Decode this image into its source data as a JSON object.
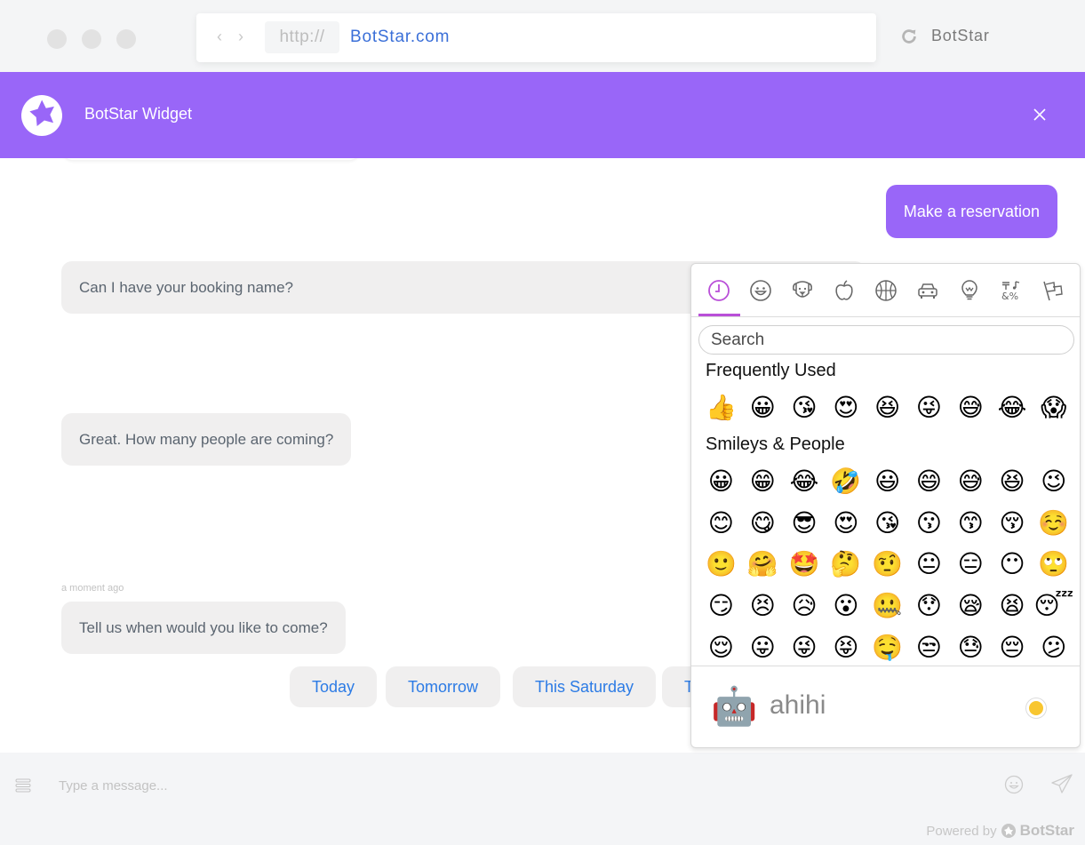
{
  "browser": {
    "protocol": "http://",
    "domain": "BotStar.com",
    "tab_title": "BotStar"
  },
  "widget": {
    "title": "BotStar Widget",
    "colors": {
      "brand": "#9966f8",
      "link": "#2c7be5",
      "bubble_bg": "#f0efef"
    }
  },
  "messages": [
    {
      "from": "user",
      "text": "Make a reservation"
    },
    {
      "from": "bot",
      "text": "Can I have your booking name?"
    },
    {
      "from": "bot",
      "text": "Great. How many people are coming?"
    },
    {
      "from": "bot",
      "text": "Tell us when would you like to come?",
      "timestamp": "a moment ago"
    }
  ],
  "quick_replies": [
    "Today",
    "Tomorrow",
    "This Saturday",
    "T"
  ],
  "composer": {
    "placeholder": "Type a message...",
    "powered_by": "Powered by",
    "powered_brand": "BotStar"
  },
  "emoji_picker": {
    "categories": [
      {
        "name": "frequently-used",
        "icon": "clock-icon",
        "active": true
      },
      {
        "name": "smileys-people",
        "icon": "smiley-icon"
      },
      {
        "name": "animals-nature",
        "icon": "dog-icon"
      },
      {
        "name": "food-drink",
        "icon": "apple-icon"
      },
      {
        "name": "activity",
        "icon": "basketball-icon"
      },
      {
        "name": "travel-places",
        "icon": "car-icon"
      },
      {
        "name": "objects",
        "icon": "lightbulb-icon"
      },
      {
        "name": "symbols",
        "icon": "symbols-icon"
      },
      {
        "name": "flags",
        "icon": "flag-icon"
      }
    ],
    "search_placeholder": "Search",
    "sections": [
      {
        "title": "Frequently Used",
        "emojis": [
          "👍",
          "😀",
          "😘",
          "😍",
          "😆",
          "😜",
          "😅",
          "😂",
          "😱"
        ]
      },
      {
        "title": "Smileys & People",
        "emojis": [
          "😀",
          "😁",
          "😂",
          "🤣",
          "😃",
          "😄",
          "😅",
          "😆",
          "😉",
          "😊",
          "😋",
          "😎",
          "😍",
          "😘",
          "😗",
          "😙",
          "😚",
          "☺️",
          "🙂",
          "🤗",
          "🤩",
          "🤔",
          "🤨",
          "😐",
          "😑",
          "😶",
          "🙄",
          "😏",
          "😣",
          "😥",
          "😮",
          "🤐",
          "😯",
          "😪",
          "😫",
          "😴",
          "😌",
          "😛",
          "😜",
          "😝",
          "🤤",
          "😒",
          "😓",
          "😔",
          "😕"
        ]
      }
    ],
    "preview": {
      "emoji": "🤖",
      "name": "ahihi"
    },
    "skin_tone_color": "#f8c630"
  }
}
